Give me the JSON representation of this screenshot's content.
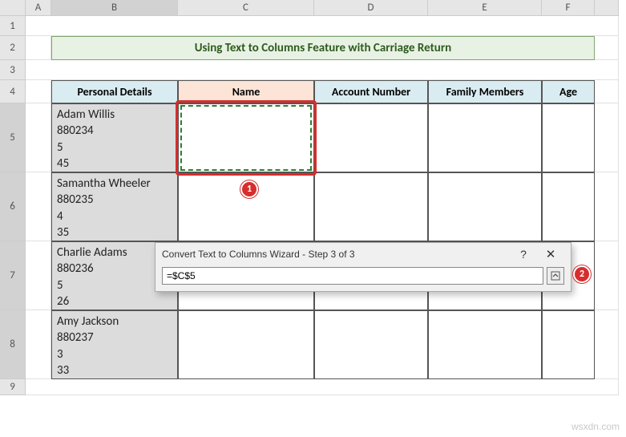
{
  "columns": [
    "A",
    "B",
    "C",
    "D",
    "E",
    "F"
  ],
  "rows": [
    "1",
    "2",
    "3",
    "4",
    "5",
    "6",
    "7",
    "8",
    "9"
  ],
  "title": "Using Text to Columns Feature with Carriage Return",
  "headers": {
    "b": "Personal Details",
    "c": "Name",
    "d": "Account Number",
    "e": "Family Members",
    "f": "Age"
  },
  "data": {
    "r5": "Adam Willis\n880234\n5\n45",
    "r6": "Samantha Wheeler\n880235\n4\n35",
    "r7": "Charlie Adams\n880236\n5\n26",
    "r8": "Amy Jackson\n880237\n3\n33"
  },
  "dialog": {
    "title": "Convert Text to Columns Wizard - Step 3 of 3",
    "value": "=$C$5",
    "help": "?",
    "close": "✕"
  },
  "badges": {
    "one": "1",
    "two": "2"
  },
  "watermark": "wsxdn.com",
  "chart_data": {
    "type": "table",
    "title": "Using Text to Columns Feature with Carriage Return",
    "columns": [
      "Personal Details",
      "Name",
      "Account Number",
      "Family Members",
      "Age"
    ],
    "rows": [
      {
        "Personal Details": "Adam Willis\n880234\n5\n45",
        "Name": "",
        "Account Number": "",
        "Family Members": "",
        "Age": ""
      },
      {
        "Personal Details": "Samantha Wheeler\n880235\n4\n35",
        "Name": "",
        "Account Number": "",
        "Family Members": "",
        "Age": ""
      },
      {
        "Personal Details": "Charlie Adams\n880236\n5\n26",
        "Name": "",
        "Account Number": "",
        "Family Members": "",
        "Age": ""
      },
      {
        "Personal Details": "Amy Jackson\n880237\n3\n33",
        "Name": "",
        "Account Number": "",
        "Family Members": "",
        "Age": ""
      }
    ]
  }
}
